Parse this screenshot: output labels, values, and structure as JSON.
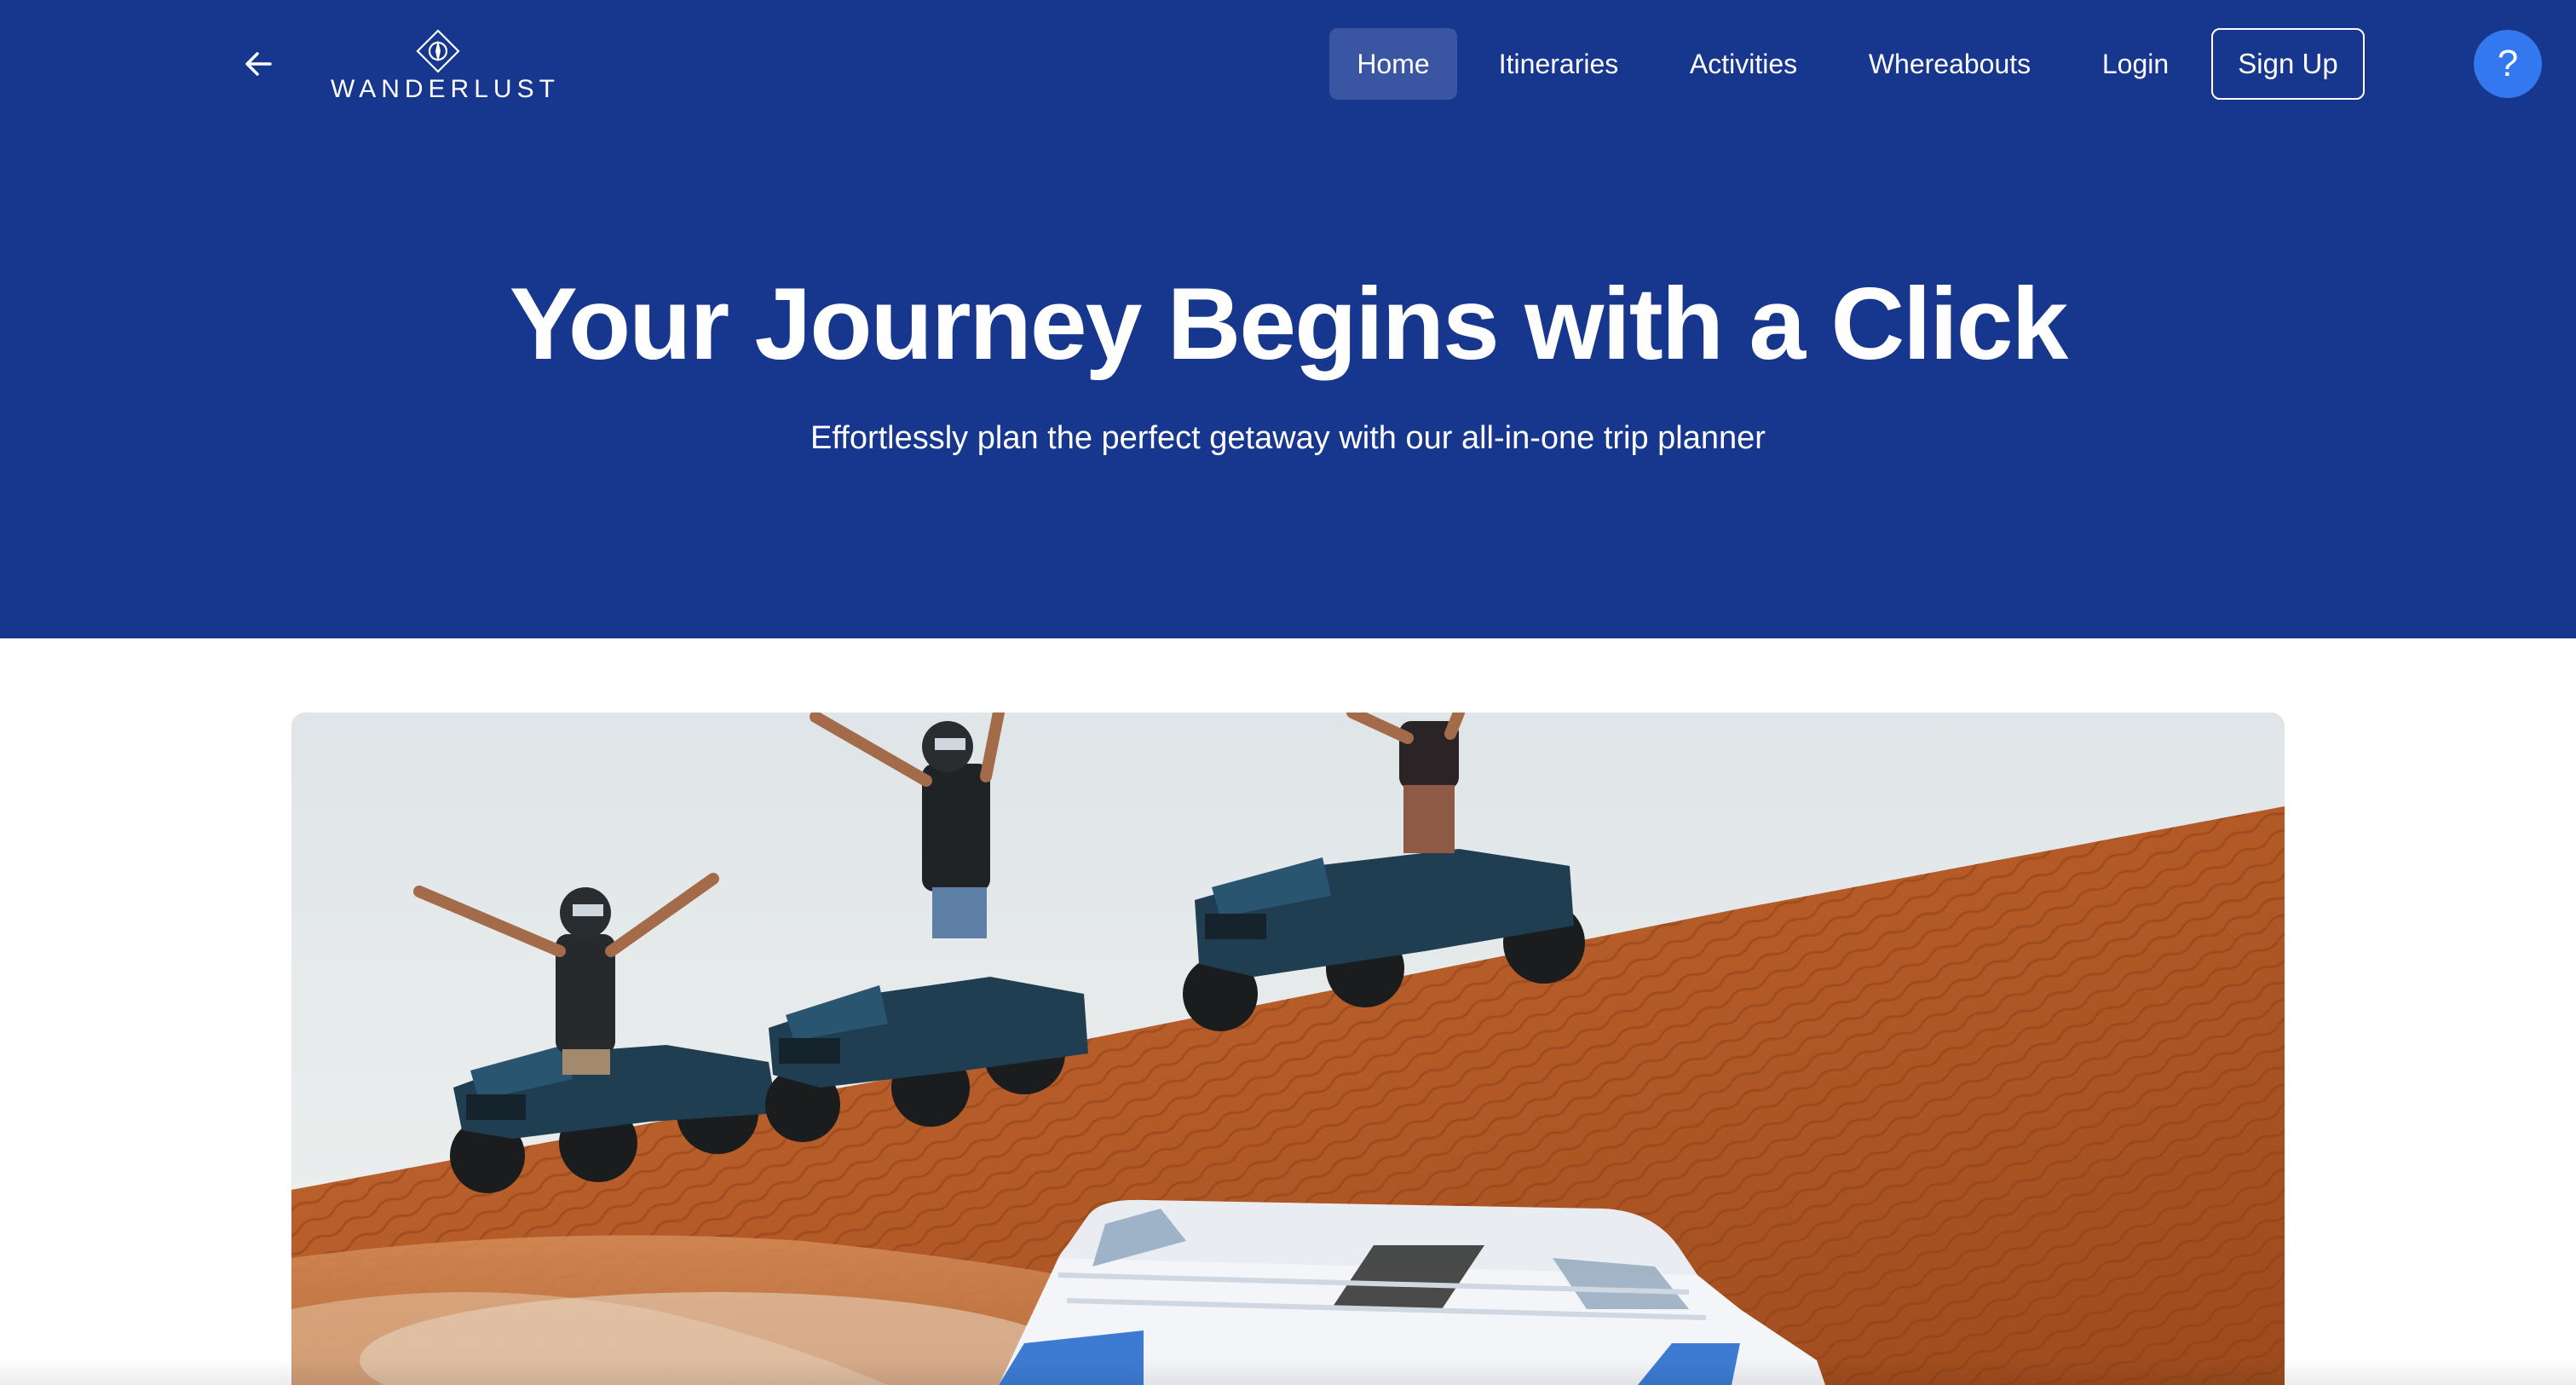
{
  "brand": {
    "name": "WANDERLUST",
    "logo_icon": "compass-diamond-icon"
  },
  "nav": {
    "back_icon": "arrow-left-icon",
    "items": [
      {
        "label": "Home",
        "active": true
      },
      {
        "label": "Itineraries",
        "active": false
      },
      {
        "label": "Activities",
        "active": false
      },
      {
        "label": "Whereabouts",
        "active": false
      },
      {
        "label": "Login",
        "active": false
      }
    ],
    "signup_label": "Sign Up",
    "help_label": "?"
  },
  "hero": {
    "title": "Your Journey Begins with a Click",
    "subtitle": "Effortlessly plan the perfect getaway with our all-in-one trip planner",
    "image_subject": "desert-quad-bikes-photo"
  },
  "colors": {
    "header_bg": "#17378f",
    "active_nav_bg": "#3a56a3",
    "help_button_bg": "#3478f0",
    "text": "#ffffff"
  }
}
